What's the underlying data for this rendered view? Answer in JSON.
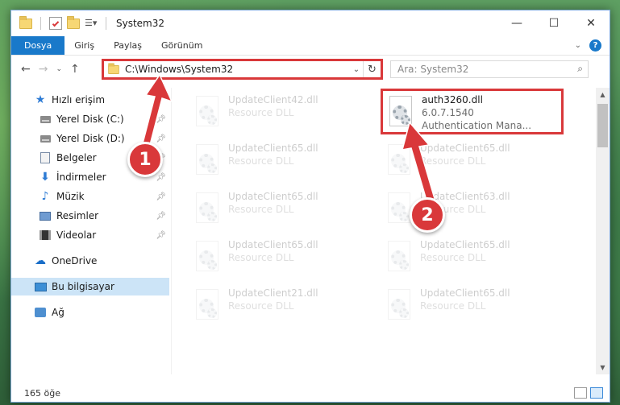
{
  "window": {
    "title": "System32",
    "controls": {
      "minimize": "—",
      "maximize": "☐",
      "close": "✕"
    }
  },
  "ribbon": {
    "tabs": [
      "Dosya",
      "Giriş",
      "Paylaş",
      "Görünüm"
    ],
    "help": "?"
  },
  "navigation": {
    "address": "C:\\Windows\\System32",
    "search_placeholder": "Ara: System32"
  },
  "sidebar": {
    "items": [
      {
        "label": "Hızlı erişim",
        "icon": "star-icon"
      },
      {
        "label": "Yerel Disk (C:)",
        "icon": "drive-icon",
        "pinned": true
      },
      {
        "label": "Yerel Disk (D:)",
        "icon": "drive-icon",
        "pinned": true
      },
      {
        "label": "Belgeler",
        "icon": "document-icon",
        "pinned": true
      },
      {
        "label": "İndirmeler",
        "icon": "download-icon",
        "pinned": true
      },
      {
        "label": "Müzik",
        "icon": "music-icon",
        "pinned": true
      },
      {
        "label": "Resimler",
        "icon": "pictures-icon",
        "pinned": true
      },
      {
        "label": "Videolar",
        "icon": "videos-icon",
        "pinned": true
      },
      {
        "label": "OneDrive",
        "icon": "cloud-icon"
      },
      {
        "label": "Bu bilgisayar",
        "icon": "computer-icon",
        "selected": true
      },
      {
        "label": "Ağ",
        "icon": "network-icon"
      }
    ]
  },
  "files": {
    "left": [
      {
        "name": "UpdateClient42.dll",
        "type": "Resource DLL"
      },
      {
        "name": "UpdateClient65.dll",
        "type": "Resource DLL"
      },
      {
        "name": "UpdateClient65.dll",
        "type": "Resource DLL"
      },
      {
        "name": "UpdateClient65.dll",
        "type": "Resource DLL"
      },
      {
        "name": "UpdateClient21.dll",
        "type": "Resource DLL"
      }
    ],
    "right": [
      {
        "name": "UpdateClient65.dll",
        "type": "Resource DLL"
      },
      {
        "name": "UpdateClient63.dll",
        "type": "Resource DLL"
      },
      {
        "name": "UpdateClient65.dll",
        "type": "Resource DLL"
      },
      {
        "name": "UpdateClient65.dll",
        "type": "Resource DLL"
      }
    ],
    "highlighted": {
      "name": "auth3260.dll",
      "version": "6.0.7.1540",
      "description": "Authentication Mana..."
    }
  },
  "status": {
    "count": "165 öğe"
  },
  "callouts": {
    "step1": "1",
    "step2": "2",
    "color": "#d9383a"
  }
}
